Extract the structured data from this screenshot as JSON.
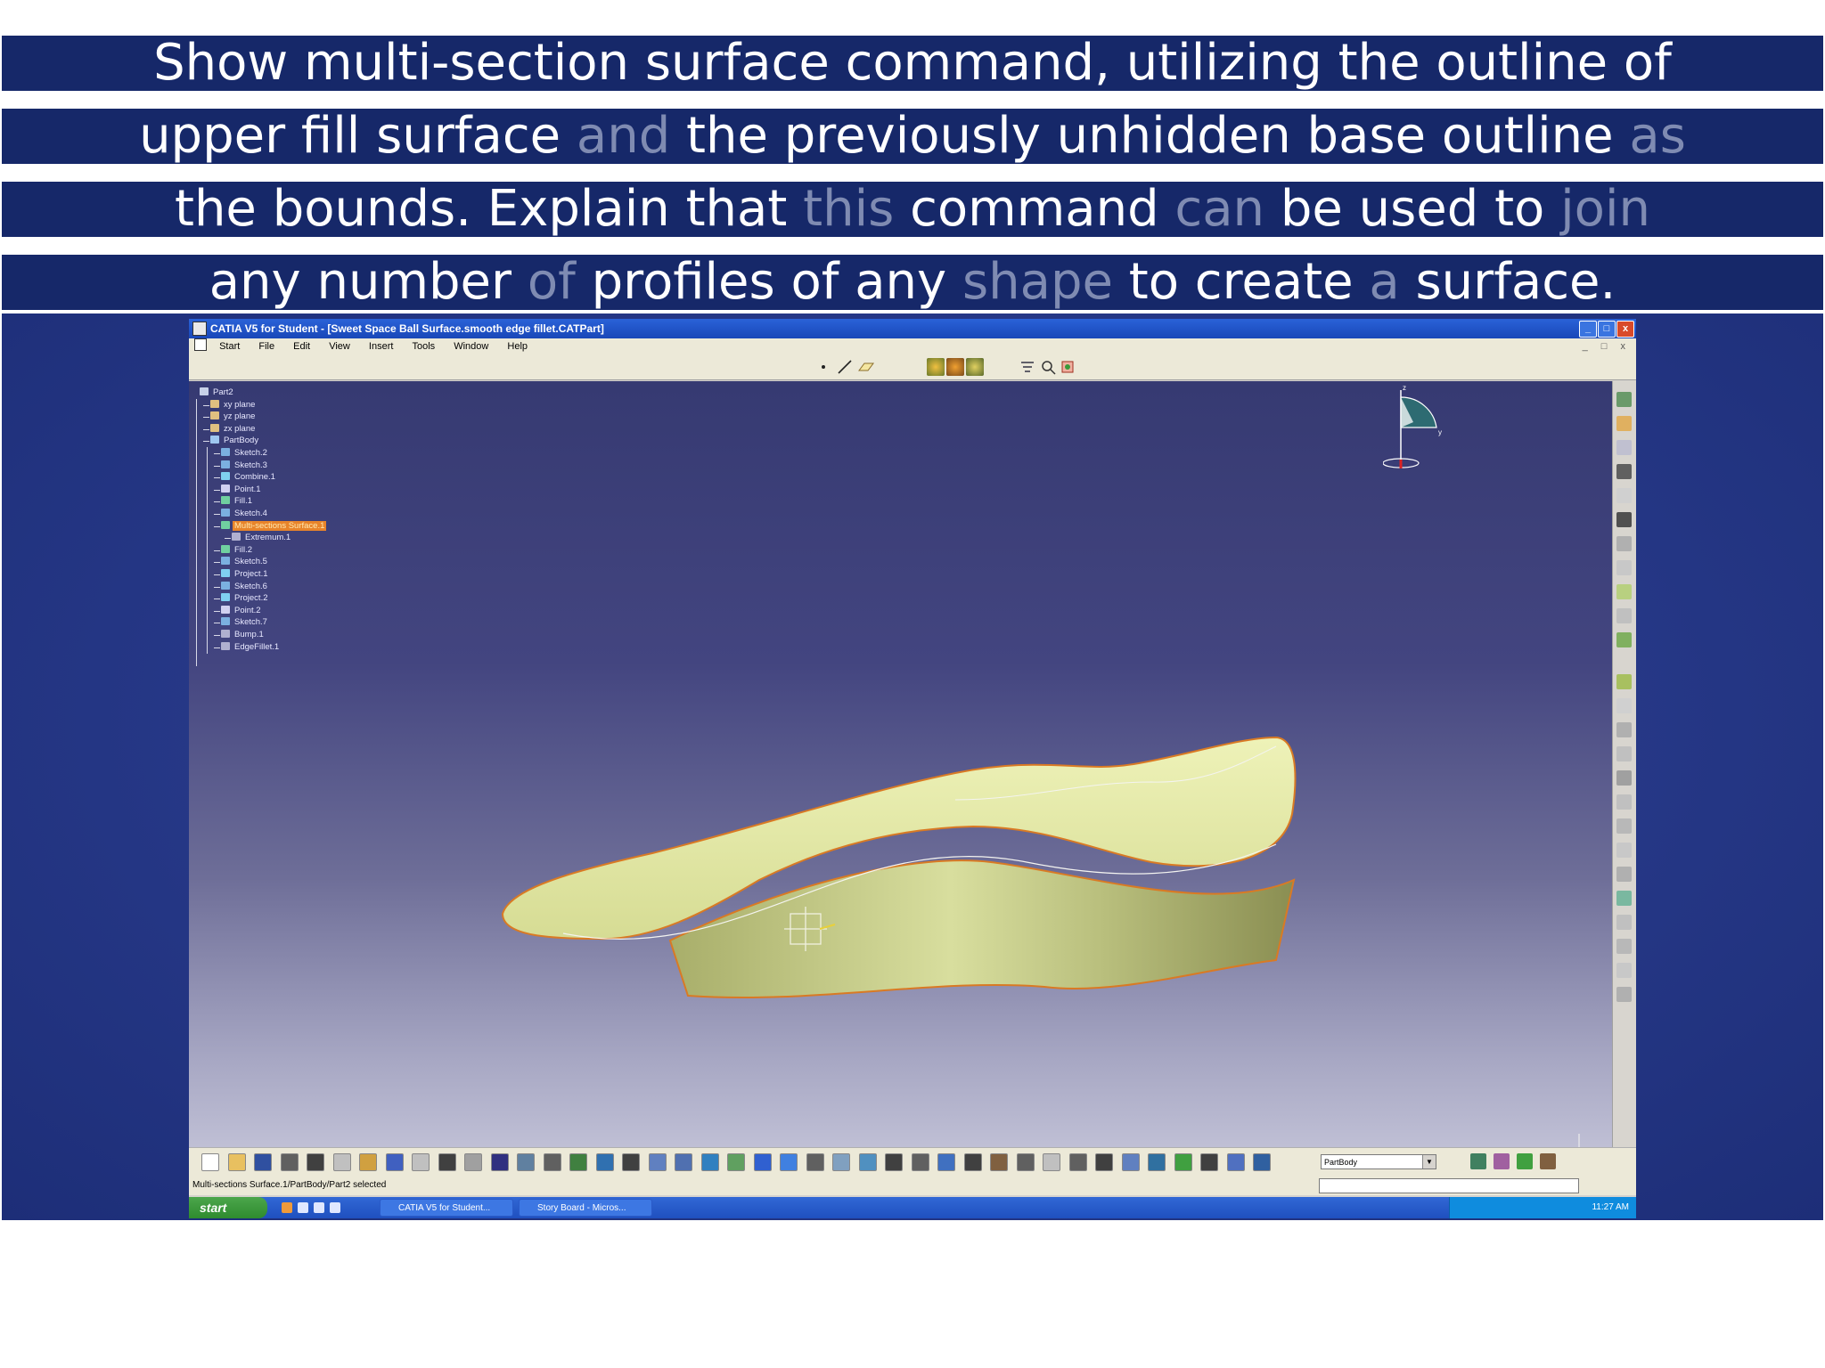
{
  "caption": {
    "lines": [
      [
        {
          "t": "Show multi-section surface command, utilizing the outline of",
          "faded": false
        }
      ],
      [
        {
          "t": "upper fill surface ",
          "faded": false
        },
        {
          "t": "and",
          "faded": true
        },
        {
          "t": " the previously unhidden base outline ",
          "faded": false
        },
        {
          "t": "as",
          "faded": true
        }
      ],
      [
        {
          "t": "the bounds. Explain that ",
          "faded": false
        },
        {
          "t": "this",
          "faded": true
        },
        {
          "t": " command ",
          "faded": false
        },
        {
          "t": "can",
          "faded": true
        },
        {
          "t": " be used to ",
          "faded": false
        },
        {
          "t": "join",
          "faded": true
        }
      ],
      [
        {
          "t": "any number ",
          "faded": false
        },
        {
          "t": "of",
          "faded": true
        },
        {
          "t": " profiles of any ",
          "faded": false
        },
        {
          "t": "shape",
          "faded": true
        },
        {
          "t": " to create ",
          "faded": false
        },
        {
          "t": "a",
          "faded": true
        },
        {
          "t": " surface.",
          "faded": false
        }
      ]
    ]
  },
  "window": {
    "title": "CATIA V5 for Student - [Sweet Space Ball Surface.smooth edge fillet.CATPart]",
    "controls": {
      "minimize": "_",
      "maximize": "□",
      "close": "x"
    }
  },
  "menu": {
    "items": [
      "Start",
      "File",
      "Edit",
      "View",
      "Insert",
      "Tools",
      "Window",
      "Help"
    ],
    "mdi_controls": "_ □ x"
  },
  "tree": {
    "nodes": [
      {
        "label": "Part2",
        "depth": 0,
        "icon": "part-icon",
        "color": "#c7d1e8",
        "selected": false
      },
      {
        "label": "xy plane",
        "depth": 1,
        "icon": "plane-icon",
        "color": "#e0c080",
        "selected": false
      },
      {
        "label": "yz plane",
        "depth": 1,
        "icon": "plane-icon",
        "color": "#e0c080",
        "selected": false
      },
      {
        "label": "zx plane",
        "depth": 1,
        "icon": "plane-icon",
        "color": "#e0c080",
        "selected": false
      },
      {
        "label": "PartBody",
        "depth": 1,
        "icon": "body-icon",
        "color": "#9ec7f0",
        "selected": false
      },
      {
        "label": "Sketch.2",
        "depth": 2,
        "icon": "sketch-icon",
        "color": "#7bb0e0",
        "selected": false
      },
      {
        "label": "Sketch.3",
        "depth": 2,
        "icon": "sketch-icon",
        "color": "#7bb0e0",
        "selected": false
      },
      {
        "label": "Combine.1",
        "depth": 2,
        "icon": "combine-icon",
        "color": "#7fd0f0",
        "selected": false
      },
      {
        "label": "Point.1",
        "depth": 2,
        "icon": "point-icon",
        "color": "#d0d0f0",
        "selected": false
      },
      {
        "label": "Fill.1",
        "depth": 2,
        "icon": "fill-icon",
        "color": "#70d0a0",
        "selected": false
      },
      {
        "label": "Sketch.4",
        "depth": 2,
        "icon": "sketch-icon",
        "color": "#7bb0e0",
        "selected": false
      },
      {
        "label": "Multi-sections Surface.1",
        "depth": 2,
        "icon": "multi-section-surface-icon",
        "color": "#70d0a0",
        "selected": true
      },
      {
        "label": "Extremum.1",
        "depth": 3,
        "icon": "extremum-icon",
        "color": "#b0b0d0",
        "selected": false
      },
      {
        "label": "Fill.2",
        "depth": 2,
        "icon": "fill-icon",
        "color": "#70d0a0",
        "selected": false
      },
      {
        "label": "Sketch.5",
        "depth": 2,
        "icon": "sketch-icon",
        "color": "#7bb0e0",
        "selected": false
      },
      {
        "label": "Project.1",
        "depth": 2,
        "icon": "project-icon",
        "color": "#7fd0f0",
        "selected": false
      },
      {
        "label": "Sketch.6",
        "depth": 2,
        "icon": "sketch-icon",
        "color": "#7bb0e0",
        "selected": false
      },
      {
        "label": "Project.2",
        "depth": 2,
        "icon": "project-icon",
        "color": "#7fd0f0",
        "selected": false
      },
      {
        "label": "Point.2",
        "depth": 2,
        "icon": "point-icon",
        "color": "#d0d0f0",
        "selected": false
      },
      {
        "label": "Sketch.7",
        "depth": 2,
        "icon": "sketch-icon",
        "color": "#7bb0e0",
        "selected": false
      },
      {
        "label": "Bump.1",
        "depth": 2,
        "icon": "bump-icon",
        "color": "#b0b0d0",
        "selected": false
      },
      {
        "label": "EdgeFillet.1",
        "depth": 2,
        "icon": "edge-fillet-icon",
        "color": "#b0b0d0",
        "selected": false
      }
    ]
  },
  "compass": {
    "axis_label_z": "z",
    "axis_label_y": "y"
  },
  "workbench_dropdown": {
    "selected": "PartBody"
  },
  "status": {
    "message": "Multi-sections Surface.1/PartBody/Part2 selected"
  },
  "taskbar": {
    "start_label": "start",
    "tasks": [
      "CATIA V5 for Student...",
      "Story Board - Micros..."
    ],
    "clock": "11:27 AM"
  },
  "colors": {
    "band_bg": "#162869",
    "faded_text": "#7f8bb2",
    "surface_fill": "#e4e8a8",
    "surface_edge": "#e07a1e",
    "selection": "#e8842a"
  }
}
